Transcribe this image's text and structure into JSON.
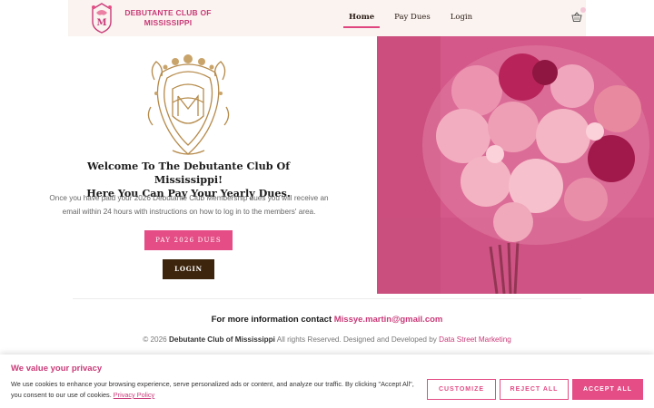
{
  "header": {
    "logo_line1": "DEBUTANTE CLUB OF",
    "logo_line2": "MISSISSIPPI",
    "nav": [
      {
        "label": "Home",
        "active": true
      },
      {
        "label": "Pay Dues",
        "active": false
      },
      {
        "label": "Login",
        "active": false
      }
    ],
    "cart_icon": "basket-icon"
  },
  "welcome": {
    "title_line1": "Welcome To The Debutante Club Of Mississippi!",
    "title_line2": "Here You Can Pay Your Yearly Dues.",
    "body": "Once you have paid your 2026 Debutante Club Membership dues you will receive an email within 24 hours with instructions on how to log in to the members' area.",
    "pay_button": "PAY 2026 DUES",
    "login_button": "LOGIN"
  },
  "footer": {
    "contact_prefix": "For more information contact",
    "contact_email": "Missye.martin@gmail.com",
    "copyright_prefix": "© 2026",
    "copyright_org": "Debutante Club of Mississippi",
    "copyright_middle": "All rights Reserved. Designed and Developed by",
    "developer": "Data Street Marketing"
  },
  "cookie": {
    "title": "We value your privacy",
    "text": "We use cookies to enhance your browsing experience, serve personalized ads or content, and analyze our traffic. By clicking \"Accept All\", you consent to our use of cookies.",
    "policy_link": "Privacy Policy",
    "customize": "CUSTOMIZE",
    "reject": "REJECT ALL",
    "accept": "ACCEPT ALL"
  },
  "colors": {
    "accent": "#e44d85",
    "brand_text": "#c93a78",
    "dark_button": "#3d240c",
    "header_bg": "#faf3ef",
    "crest_gold": "#b58a4a"
  }
}
